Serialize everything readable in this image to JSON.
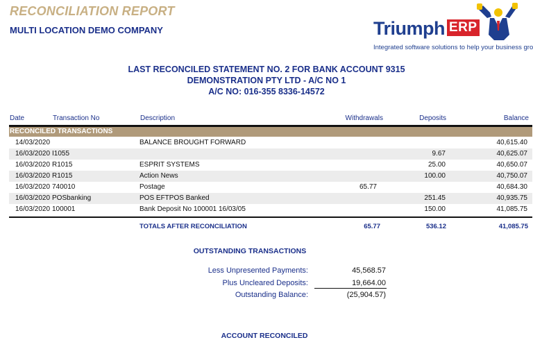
{
  "report": {
    "title": "RECONCILIATION REPORT",
    "company": "MULTI LOCATION DEMO COMPANY"
  },
  "logo": {
    "word": "Triumph",
    "badge": "ERP",
    "tagline": "Integrated software solutions to help your business grow",
    "colors": {
      "primary": "#1f3f8f",
      "badge": "#d8242b",
      "accent": "#f2c200"
    }
  },
  "statement": {
    "line1": "LAST RECONCILED STATEMENT NO. 2 FOR BANK ACCOUNT 9315",
    "line2": "DEMONSTRATION PTY LTD - A/C NO 1",
    "line3": "A/C NO: 016-355 8336-14572"
  },
  "columns": {
    "date": "Date",
    "txn_no": "Transaction No",
    "description": "Description",
    "withdrawals": "Withdrawals",
    "deposits": "Deposits",
    "balance": "Balance"
  },
  "section_label": "RECONCILED TRANSACTIONS",
  "rows": [
    {
      "date": "14/03/2020",
      "no": "",
      "desc": "BALANCE BROUGHT FORWARD",
      "wd": "",
      "dep": "",
      "bal": "40,615.40"
    },
    {
      "date": "16/03/2020",
      "no": "I1055",
      "desc": "",
      "wd": "",
      "dep": "9.67",
      "bal": "40,625.07"
    },
    {
      "date": "16/03/2020",
      "no": "R1015",
      "desc": "ESPRIT SYSTEMS",
      "wd": "",
      "dep": "25.00",
      "bal": "40,650.07"
    },
    {
      "date": "16/03/2020",
      "no": "R1015",
      "desc": "Action News",
      "wd": "",
      "dep": "100.00",
      "bal": "40,750.07"
    },
    {
      "date": "16/03/2020",
      "no": "740010",
      "desc": "Postage",
      "wd": "65.77",
      "dep": "",
      "bal": "40,684.30"
    },
    {
      "date": "16/03/2020",
      "no": "POSbanking",
      "desc": "POS EFTPOS Banked",
      "wd": "",
      "dep": "251.45",
      "bal": "40,935.75"
    },
    {
      "date": "16/03/2020",
      "no": "100001",
      "desc": "Bank Deposit No 100001 16/03/05",
      "wd": "",
      "dep": "150.00",
      "bal": "41,085.75"
    }
  ],
  "totals": {
    "label": "TOTALS AFTER RECONCILIATION",
    "withdrawals": "65.77",
    "deposits": "536.12",
    "balance": "41,085.75"
  },
  "outstanding": {
    "title": "OUTSTANDING TRANSACTIONS",
    "items": [
      {
        "label": "Less Unpresented Payments:",
        "value": "45,568.57"
      },
      {
        "label": "Plus Uncleared Deposits:",
        "value": "19,664.00"
      },
      {
        "label": "Outstanding Balance:",
        "value": "(25,904.57)"
      }
    ]
  },
  "footer": {
    "status": "ACCOUNT RECONCILED"
  }
}
